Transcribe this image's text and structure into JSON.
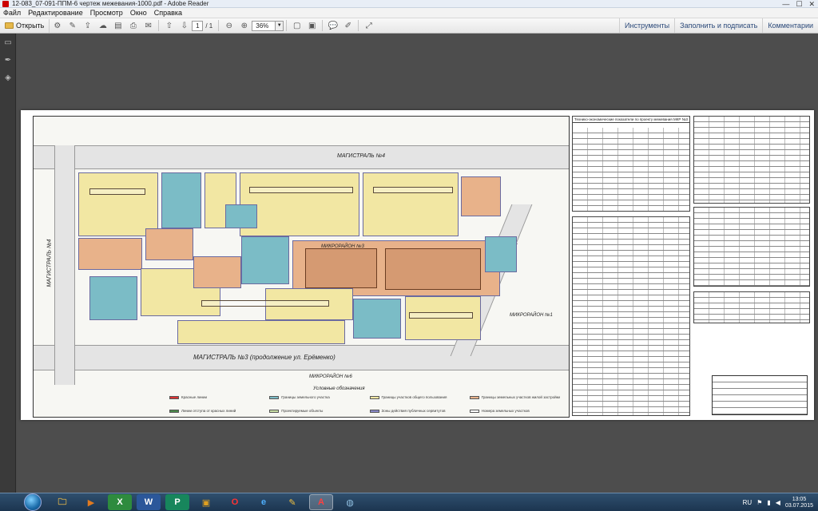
{
  "window": {
    "title": "12-083_07-091-ППМ-6 чертеж межевания-1000.pdf - Adobe Reader",
    "controls": [
      "—",
      "☐",
      "✕"
    ]
  },
  "menu": [
    "Файл",
    "Редактирование",
    "Просмотр",
    "Окно",
    "Справка"
  ],
  "toolbar": {
    "open_label": "Открыть",
    "page_current": "1",
    "page_total": "/ 1",
    "zoom": "36%",
    "right_panels": [
      "Инструменты",
      "Заполнить и подписать",
      "Комментарии"
    ]
  },
  "drawing": {
    "roads": {
      "top": "МАГИСТРАЛЬ №4",
      "bottom": "МАГИСТРАЛЬ №3 (продолжение ул. Ерёменко)",
      "left": "МАГИСТРАЛЬ №4",
      "right": "МАГИСТРАЛЬ №4",
      "microdistrict_center": "МИКРОРАЙОН №3",
      "microdistrict_bottom": "МИКРОРАЙОН №6",
      "microdistrict_right": "МИКРОРАЙОН №1"
    },
    "legend_title": "Условные обозначения",
    "legend": [
      {
        "label": "Красные линии",
        "color": "#d33"
      },
      {
        "label": "Границы земельного участка",
        "color": "#7bbcc6"
      },
      {
        "label": "Границы участков общего пользования",
        "color": "#f2e7a3"
      },
      {
        "label": "Границы земельных участков жилой застройки",
        "color": "#e8b28a"
      },
      {
        "label": "Линии отступа от красных линий",
        "color": "#4a8a4a"
      },
      {
        "label": "Проектируемые объекты",
        "color": "#c9dfa6"
      },
      {
        "label": "Зоны действия публичных сервитутов",
        "color": "#8888c8"
      },
      {
        "label": "Номера земельных участков",
        "color": "#ffffff"
      }
    ],
    "tables_title": "Технико-экономические показатели по проекту межевания МКР №3"
  },
  "taskbar": {
    "apps": [
      {
        "name": "explorer",
        "glyph": "🗀",
        "color": "#e6b84a"
      },
      {
        "name": "media",
        "glyph": "▶",
        "color": "#e07a20"
      },
      {
        "name": "excel",
        "glyph": "X",
        "color": "#2e8b3e"
      },
      {
        "name": "word",
        "glyph": "W",
        "color": "#2b579a"
      },
      {
        "name": "publisher",
        "glyph": "P",
        "color": "#17865c"
      },
      {
        "name": "archive",
        "glyph": "▣",
        "color": "#c0392b"
      },
      {
        "name": "opera",
        "glyph": "O",
        "color": "#cc1b1b"
      },
      {
        "name": "ie",
        "glyph": "e",
        "color": "#2d8ed8"
      },
      {
        "name": "tool",
        "glyph": "✎",
        "color": "#d4a017"
      },
      {
        "name": "acrobat",
        "glyph": "A",
        "color": "#c81c1c"
      },
      {
        "name": "network",
        "glyph": "◍",
        "color": "#5a8fc0"
      }
    ],
    "lang": "RU",
    "time": "13:05",
    "date": "03.07.2015"
  }
}
